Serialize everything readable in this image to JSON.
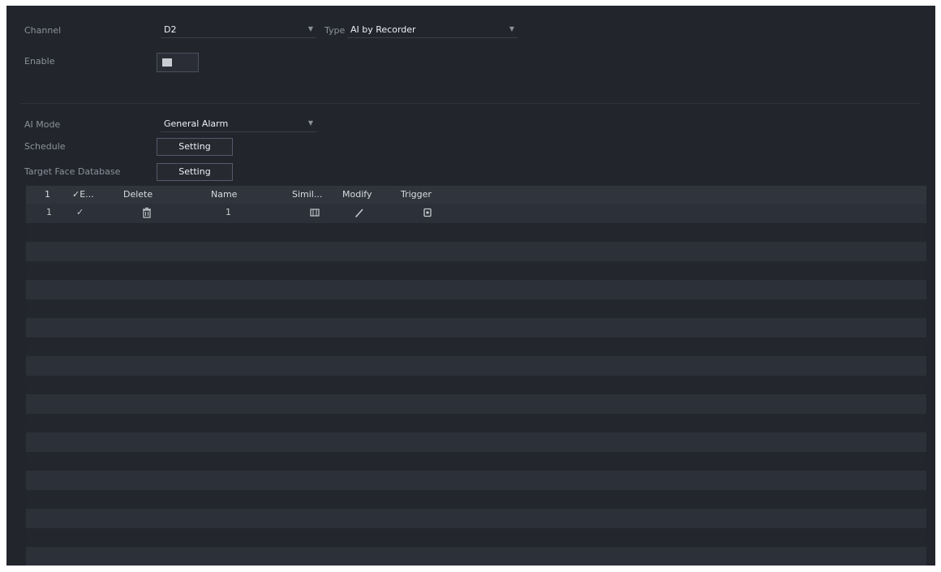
{
  "form": {
    "channel_label": "Channel",
    "channel_value": "D2",
    "type_label": "Type",
    "type_value": "AI by Recorder",
    "enable_label": "Enable",
    "enable_on": false,
    "ai_mode_label": "AI Mode",
    "ai_mode_value": "General Alarm",
    "schedule_label": "Schedule",
    "schedule_button": "Setting",
    "target_face_db_label": "Target Face Database",
    "target_face_db_button": "Setting"
  },
  "table": {
    "columns": [
      "1",
      "✓E...",
      "Delete",
      "Name",
      "Simil...",
      "Modify",
      "Trigger"
    ],
    "rows": [
      {
        "index": "1",
        "enabled": "✓",
        "delete_icon": "trash-icon",
        "name": "1",
        "similarity_icon": "similarity-icon",
        "modify_icon": "pencil-icon",
        "trigger_icon": "trigger-icon"
      }
    ],
    "empty_row_count": 18
  },
  "icons": {
    "arrow": "⌄"
  }
}
